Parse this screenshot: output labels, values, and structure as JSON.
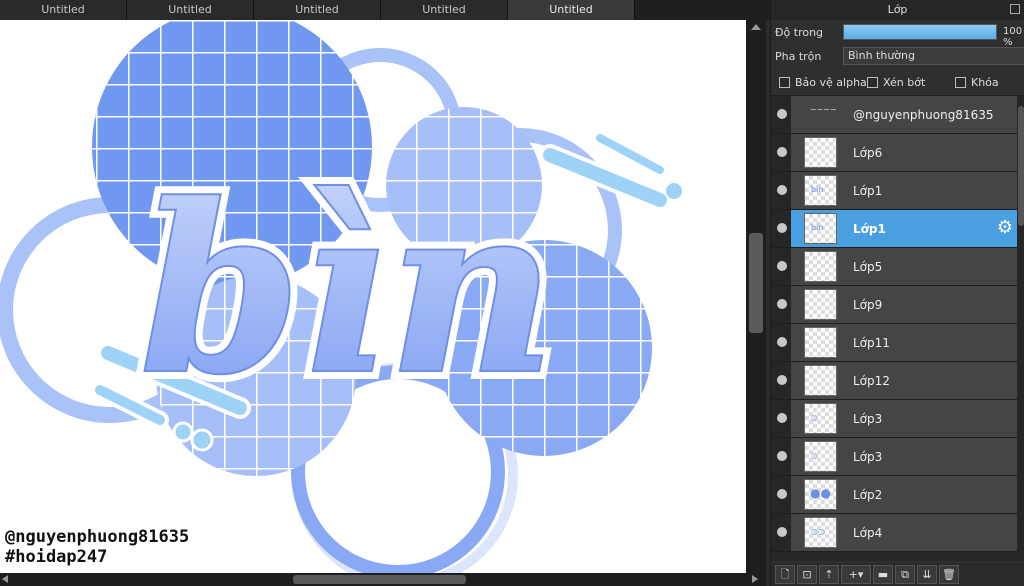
{
  "tabs": [
    {
      "label": "Untitled"
    },
    {
      "label": "Untitled"
    },
    {
      "label": "Untitled"
    },
    {
      "label": "Untitled"
    },
    {
      "label": "Untitled"
    }
  ],
  "canvas": {
    "watermark_line1": "@nguyenphuong81635",
    "watermark_line2": "#hoidap247",
    "artwork_text": "bìn"
  },
  "panel": {
    "title": "Lớp",
    "opacity_label": "Độ trong",
    "opacity_value": "100 %",
    "opacity_level": 1.0,
    "blend_label": "Pha trộn",
    "blend_value": "Bình thường",
    "protect_alpha": "Bảo vệ alpha",
    "clipping": "Xén bớt",
    "lock": "Khóa"
  },
  "layers": [
    {
      "name": "@nguyenphuong81635",
      "selected": false
    },
    {
      "name": "Lớp6",
      "selected": false
    },
    {
      "name": "Lớp1",
      "selected": false
    },
    {
      "name": "Lớp1",
      "selected": true
    },
    {
      "name": "Lớp5",
      "selected": false
    },
    {
      "name": "Lớp9",
      "selected": false
    },
    {
      "name": "Lớp11",
      "selected": false
    },
    {
      "name": "Lớp12",
      "selected": false
    },
    {
      "name": "Lớp3",
      "selected": false
    },
    {
      "name": "Lớp3",
      "selected": false
    },
    {
      "name": "Lớp2",
      "selected": false
    },
    {
      "name": "Lớp4",
      "selected": false
    }
  ],
  "colors": {
    "accent": "#4a9fe0",
    "art_blue": "#6f97f2",
    "art_light": "#a9c2f8",
    "art_cyan": "#9fd2f7"
  },
  "icons": [
    "new-layer-icon",
    "new-raster-icon",
    "import-icon",
    "add-icon",
    "folder-icon",
    "duplicate-icon",
    "merge-icon",
    "trash-icon"
  ]
}
